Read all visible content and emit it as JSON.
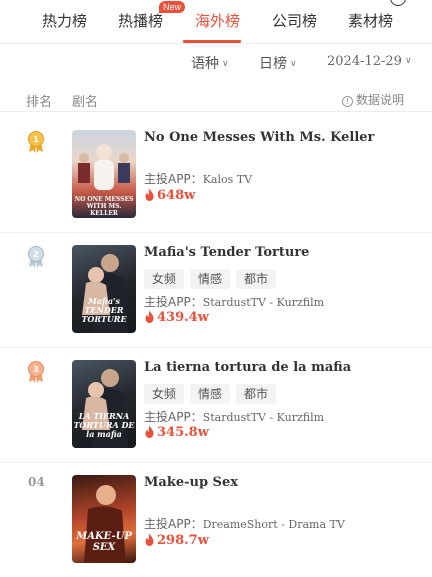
{
  "tabs": [
    {
      "label": "热力榜",
      "active": false
    },
    {
      "label": "热播榜",
      "active": false,
      "badge": "New"
    },
    {
      "label": "海外榜",
      "active": true
    },
    {
      "label": "公司榜",
      "active": false
    },
    {
      "label": "素材榜",
      "active": false
    }
  ],
  "filters": {
    "language": "语种",
    "period": "日榜",
    "date": "2024-12-29"
  },
  "header": {
    "rank": "排名",
    "drama": "剧名",
    "info": "数据说明"
  },
  "colors": {
    "accent": "#e8503a",
    "gold": "#f0a72a",
    "silver": "#b9c6d4",
    "bronze": "#f09a6e"
  },
  "rows": [
    {
      "rank": "1",
      "medal": "gold",
      "title": "No One Messes With Ms. Keller",
      "poster_text": "NO ONE MESSES WITH MS. KELLER",
      "tags": [],
      "app_label": "主投APP：",
      "app": "Kalos TV",
      "heat": "648w"
    },
    {
      "rank": "2",
      "medal": "silver",
      "title": "Mafia's Tender Torture",
      "poster_text": "Mafia's TENDER TORTURE",
      "tags": [
        "女频",
        "情感",
        "都市"
      ],
      "app_label": "主投APP：",
      "app": "StardustTV - Kurzfilm",
      "heat": "439.4w"
    },
    {
      "rank": "3",
      "medal": "bronze",
      "title": "La tierna tortura de la mafia",
      "poster_text": "LA TIERNA TORTURA DE la mafia",
      "tags": [
        "女频",
        "情感",
        "都市"
      ],
      "app_label": "主投APP：",
      "app": "StardustTV - Kurzfilm",
      "heat": "345.8w"
    },
    {
      "rank": "04",
      "medal": "",
      "title": "Make-up Sex",
      "poster_text": "MAKE-UP SEX",
      "tags": [],
      "app_label": "主投APP：",
      "app": "DreameShort - Drama TV",
      "heat": "298.7w"
    }
  ]
}
